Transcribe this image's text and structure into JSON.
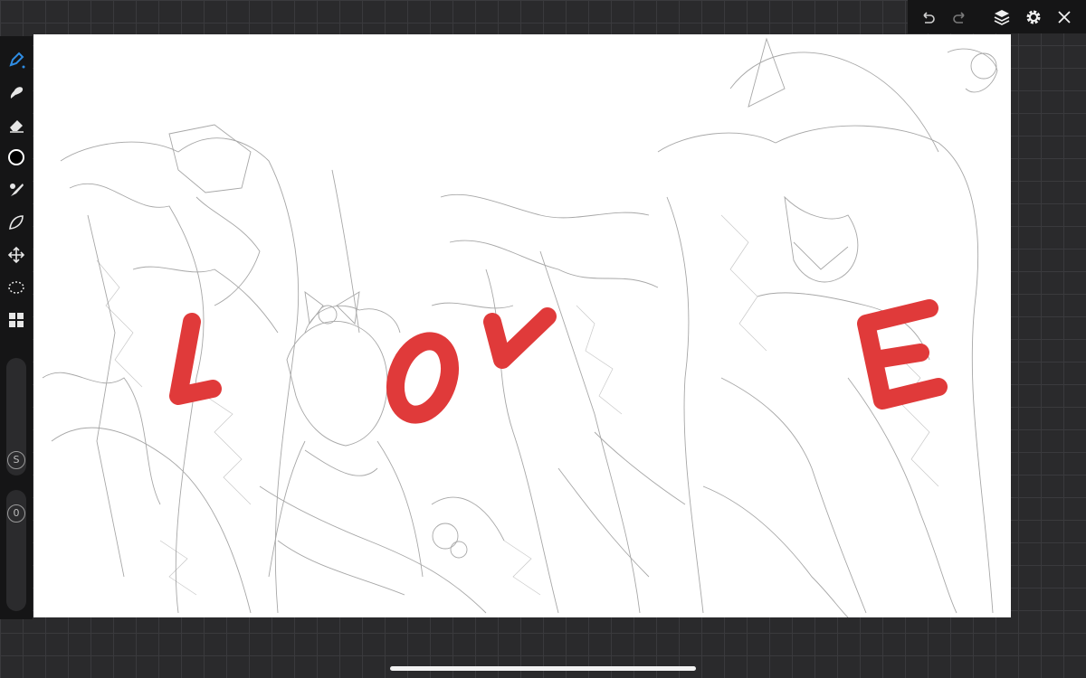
{
  "toolbar": {
    "tools": [
      {
        "name": "pen-icon",
        "active": true
      },
      {
        "name": "smudge-icon"
      },
      {
        "name": "eraser-icon"
      },
      {
        "name": "color-icon",
        "color": "#000000"
      },
      {
        "name": "brush-icon"
      },
      {
        "name": "lasso-fill-icon"
      },
      {
        "name": "move-icon"
      },
      {
        "name": "selection-icon"
      },
      {
        "name": "gallery-icon"
      }
    ],
    "size_slider_label": "S",
    "opacity_slider_label": "0"
  },
  "topbar": {
    "buttons": [
      "undo-icon",
      "redo-icon",
      "layers-icon",
      "settings-icon",
      "close-icon"
    ]
  },
  "canvas": {
    "letters": [
      "L",
      "O",
      "V",
      "E"
    ],
    "letter_color": "#e03a3a",
    "sketch_color": "#8a8a8a"
  },
  "colors": {
    "accent": "#2f8de4",
    "toolbar_bg": "#151516",
    "background": "#2a2a2c"
  }
}
